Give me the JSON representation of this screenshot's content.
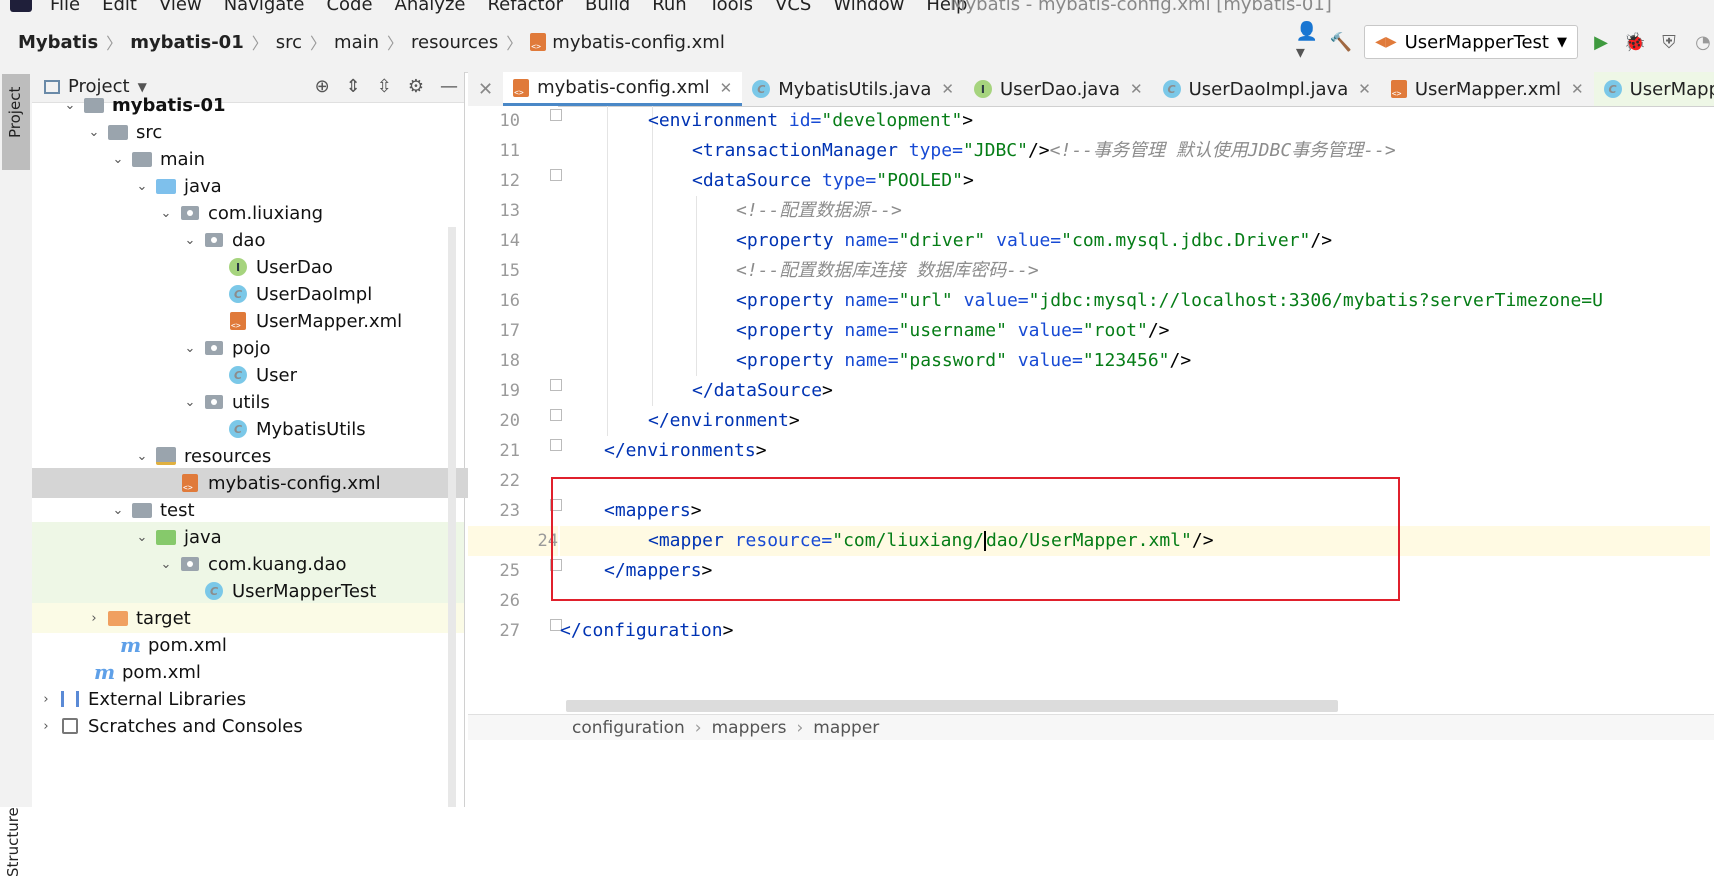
{
  "menu": {
    "items": [
      "File",
      "Edit",
      "View",
      "Navigate",
      "Code",
      "Analyze",
      "Refactor",
      "Build",
      "Run",
      "Tools",
      "VCS",
      "Window",
      "Help"
    ],
    "window_title": "Mybatis - mybatis-config.xml [mybatis-01]"
  },
  "breadcrumbs": [
    "Mybatis",
    "mybatis-01",
    "src",
    "main",
    "resources",
    "mybatis-config.xml"
  ],
  "run_config": "UserMapperTest",
  "project_panel": {
    "title": "Project",
    "side_tab": "Project",
    "structure_tab": "Structure",
    "tree": [
      {
        "label": "mybatis-01",
        "bold": true
      },
      {
        "label": "src"
      },
      {
        "label": "main"
      },
      {
        "label": "java"
      },
      {
        "label": "com.liuxiang"
      },
      {
        "label": "dao"
      },
      {
        "label": "UserDao"
      },
      {
        "label": "UserDaoImpl"
      },
      {
        "label": "UserMapper.xml"
      },
      {
        "label": "pojo"
      },
      {
        "label": "User"
      },
      {
        "label": "utils"
      },
      {
        "label": "MybatisUtils"
      },
      {
        "label": "resources"
      },
      {
        "label": "mybatis-config.xml"
      },
      {
        "label": "test"
      },
      {
        "label": "java"
      },
      {
        "label": "com.kuang.dao"
      },
      {
        "label": "UserMapperTest"
      },
      {
        "label": "target"
      },
      {
        "label": "pom.xml"
      },
      {
        "label": "pom.xml"
      },
      {
        "label": "External Libraries"
      },
      {
        "label": "Scratches and Consoles"
      }
    ]
  },
  "tabs": [
    {
      "label": "mybatis-config.xml",
      "icon": "xml-file-icon"
    },
    {
      "label": "MybatisUtils.java",
      "icon": "class-icon"
    },
    {
      "label": "UserDao.java",
      "icon": "interface-icon"
    },
    {
      "label": "UserDaoImpl.java",
      "icon": "class-icon"
    },
    {
      "label": "UserMapper.xml",
      "icon": "xml-file-icon"
    },
    {
      "label": "UserMapperTest",
      "icon": "test-class-icon"
    }
  ],
  "line_numbers": [
    "10",
    "11",
    "12",
    "13",
    "14",
    "15",
    "16",
    "17",
    "18",
    "19",
    "20",
    "21",
    "22",
    "23",
    "24",
    "25",
    "26",
    "27"
  ],
  "code": {
    "l10": {
      "tag": "<environment",
      "attr": " id=",
      "val": "\"development\"",
      "end": ">"
    },
    "l11": {
      "tag": "<transactionManager",
      "attr": " type=",
      "val": "\"JDBC\"",
      "end": "/>",
      "comment": "<!--事务管理 默认使用JDBC事务管理-->"
    },
    "l12": {
      "tag": "<dataSource",
      "attr": " type=",
      "val": "\"POOLED\"",
      "end": ">"
    },
    "l13": {
      "comment": "<!--配置数据源-->"
    },
    "l14": {
      "tag": "<property",
      "attr1": " name=",
      "val1": "\"driver\"",
      "attr2": " value=",
      "val2": "\"com.mysql.jdbc.Driver\"",
      "end": "/>"
    },
    "l15": {
      "comment": "<!--配置数据库连接 数据库密码-->"
    },
    "l16": {
      "tag": "<property",
      "attr1": " name=",
      "val1": "\"url\"",
      "attr2": " value=",
      "val2": "\"jdbc:mysql://localhost:3306/mybatis?serverTimezone=U"
    },
    "l17": {
      "tag": "<property",
      "attr1": " name=",
      "val1": "\"username\"",
      "attr2": " value=",
      "val2": "\"root\"",
      "end": "/>"
    },
    "l18": {
      "tag": "<property",
      "attr1": " name=",
      "val1": "\"password\"",
      "attr2": " value=",
      "val2": "\"123456\"",
      "end": "/>"
    },
    "l19": {
      "tag": "</dataSource",
      "end": ">"
    },
    "l20": {
      "tag": "</environment",
      "end": ">"
    },
    "l21": {
      "tag": "</environments",
      "end": ">"
    },
    "l23": {
      "tag": "<mappers",
      "end": ">"
    },
    "l24": {
      "tag": "<mapper",
      "attr": " resource=",
      "val_a": "\"com/liuxiang/",
      "val_b": "dao/UserMapper.xml\"",
      "end": "/>"
    },
    "l25": {
      "tag": "</mappers",
      "end": ">"
    },
    "l27": {
      "tag": "</configuration",
      "end": ">"
    }
  },
  "status_breadcrumb": [
    "configuration",
    "mappers",
    "mapper"
  ],
  "colors": {
    "tag": "#0033b3",
    "attr": "#174ad4",
    "value": "#067d17",
    "comment": "#8c8c8c",
    "highlight_box": "#e0202c"
  }
}
